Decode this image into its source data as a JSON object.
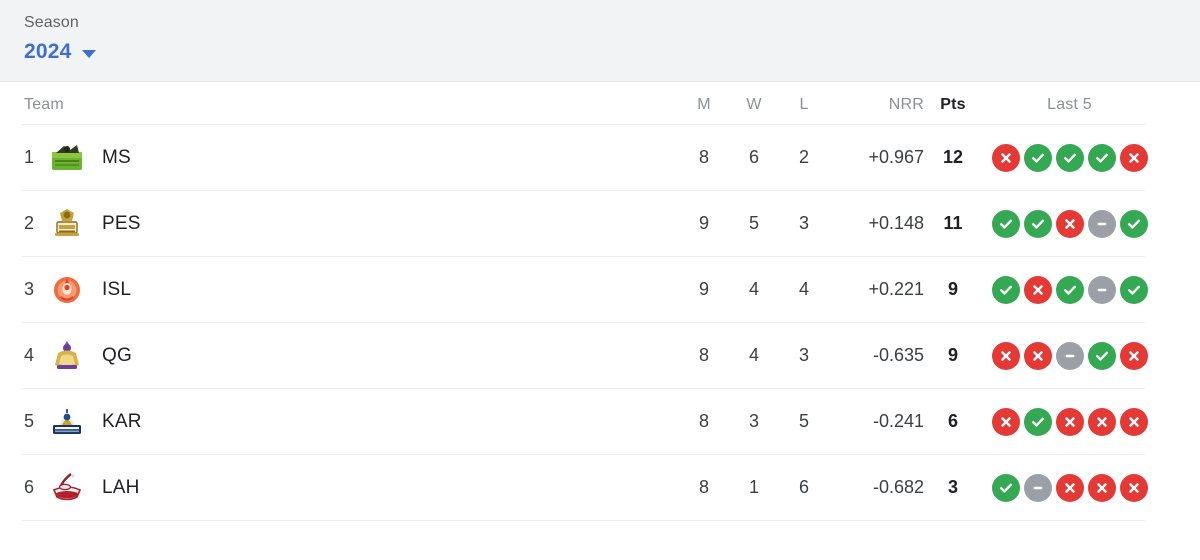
{
  "season": {
    "label": "Season",
    "value": "2024",
    "caret_icon": "chevron-down-icon"
  },
  "table": {
    "columns": {
      "team": "Team",
      "m": "M",
      "w": "W",
      "l": "L",
      "nrr": "NRR",
      "pts": "Pts",
      "last5": "Last 5"
    },
    "rows": [
      {
        "rank": "1",
        "team": "MS",
        "logo": "ms-logo",
        "m": "8",
        "w": "6",
        "l": "2",
        "nrr": "+0.967",
        "pts": "12",
        "last5": [
          "L",
          "W",
          "W",
          "W",
          "L"
        ]
      },
      {
        "rank": "2",
        "team": "PES",
        "logo": "pes-logo",
        "m": "9",
        "w": "5",
        "l": "3",
        "nrr": "+0.148",
        "pts": "11",
        "last5": [
          "W",
          "W",
          "L",
          "N",
          "W"
        ]
      },
      {
        "rank": "3",
        "team": "ISL",
        "logo": "isl-logo",
        "m": "9",
        "w": "4",
        "l": "4",
        "nrr": "+0.221",
        "pts": "9",
        "last5": [
          "W",
          "L",
          "W",
          "N",
          "W"
        ]
      },
      {
        "rank": "4",
        "team": "QG",
        "logo": "qg-logo",
        "m": "8",
        "w": "4",
        "l": "3",
        "nrr": "-0.635",
        "pts": "9",
        "last5": [
          "L",
          "L",
          "N",
          "W",
          "L"
        ]
      },
      {
        "rank": "5",
        "team": "KAR",
        "logo": "kar-logo",
        "m": "8",
        "w": "3",
        "l": "5",
        "nrr": "-0.241",
        "pts": "6",
        "last5": [
          "L",
          "W",
          "L",
          "L",
          "L"
        ]
      },
      {
        "rank": "6",
        "team": "LAH",
        "logo": "lah-logo",
        "m": "8",
        "w": "1",
        "l": "6",
        "nrr": "-0.682",
        "pts": "3",
        "last5": [
          "W",
          "N",
          "L",
          "L",
          "L"
        ]
      }
    ]
  },
  "colors": {
    "header_band": "#f1f3f5",
    "accent_blue": "#3d6fd0",
    "win_green": "#34a853",
    "loss_red": "#e53935",
    "no_result_gray": "#9aa0a6",
    "text_primary": "#202124",
    "text_muted": "#8b9096"
  }
}
